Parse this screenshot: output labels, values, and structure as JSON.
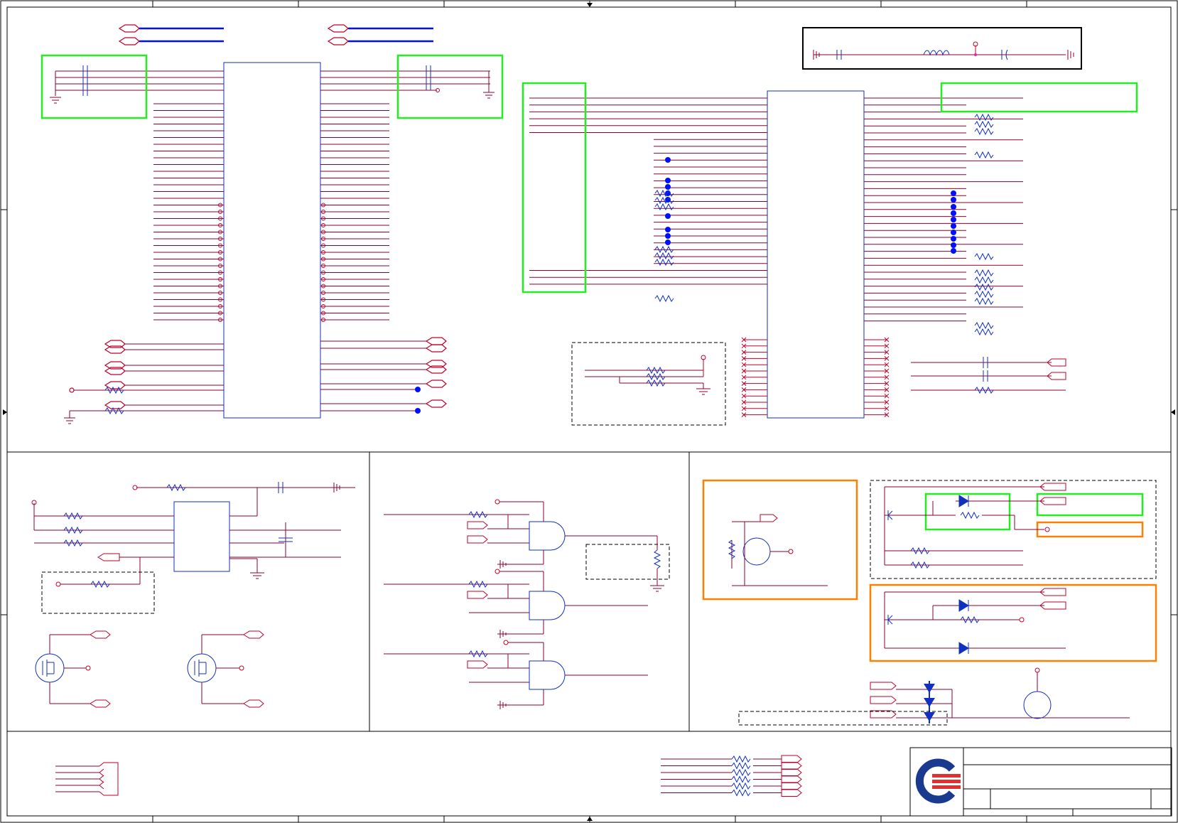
{
  "schematic": {
    "colors": {
      "wire": "#c0002a",
      "wire_dark": "#8a0030",
      "part": "#1030c0",
      "net_blue": "#0010ff",
      "border": "#000000",
      "highlight_green": "#22ee22",
      "highlight_orange": "#ff8000",
      "junction": "#e020c0",
      "logo_blue": "#1a3a8f",
      "logo_red": "#e03030"
    },
    "annotations": {
      "green_boxes": 6,
      "orange_boxes": 3,
      "dashed_boxes": 5
    },
    "logo": {
      "name": "company-logo"
    },
    "title_block": {
      "title": "",
      "doc_number": "",
      "revision": "",
      "sheet": ""
    }
  }
}
